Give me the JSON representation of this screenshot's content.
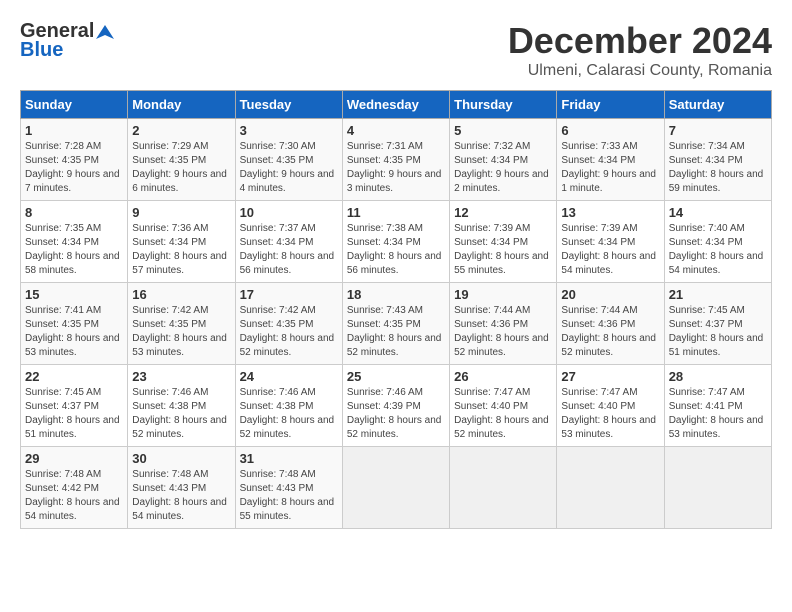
{
  "logo": {
    "general": "General",
    "blue": "Blue"
  },
  "header": {
    "month": "December 2024",
    "location": "Ulmeni, Calarasi County, Romania"
  },
  "weekdays": [
    "Sunday",
    "Monday",
    "Tuesday",
    "Wednesday",
    "Thursday",
    "Friday",
    "Saturday"
  ],
  "weeks": [
    [
      {
        "day": "1",
        "sunrise": "7:28 AM",
        "sunset": "4:35 PM",
        "daylight": "9 hours and 7 minutes."
      },
      {
        "day": "2",
        "sunrise": "7:29 AM",
        "sunset": "4:35 PM",
        "daylight": "9 hours and 6 minutes."
      },
      {
        "day": "3",
        "sunrise": "7:30 AM",
        "sunset": "4:35 PM",
        "daylight": "9 hours and 4 minutes."
      },
      {
        "day": "4",
        "sunrise": "7:31 AM",
        "sunset": "4:35 PM",
        "daylight": "9 hours and 3 minutes."
      },
      {
        "day": "5",
        "sunrise": "7:32 AM",
        "sunset": "4:34 PM",
        "daylight": "9 hours and 2 minutes."
      },
      {
        "day": "6",
        "sunrise": "7:33 AM",
        "sunset": "4:34 PM",
        "daylight": "9 hours and 1 minute."
      },
      {
        "day": "7",
        "sunrise": "7:34 AM",
        "sunset": "4:34 PM",
        "daylight": "8 hours and 59 minutes."
      }
    ],
    [
      {
        "day": "8",
        "sunrise": "7:35 AM",
        "sunset": "4:34 PM",
        "daylight": "8 hours and 58 minutes."
      },
      {
        "day": "9",
        "sunrise": "7:36 AM",
        "sunset": "4:34 PM",
        "daylight": "8 hours and 57 minutes."
      },
      {
        "day": "10",
        "sunrise": "7:37 AM",
        "sunset": "4:34 PM",
        "daylight": "8 hours and 56 minutes."
      },
      {
        "day": "11",
        "sunrise": "7:38 AM",
        "sunset": "4:34 PM",
        "daylight": "8 hours and 56 minutes."
      },
      {
        "day": "12",
        "sunrise": "7:39 AM",
        "sunset": "4:34 PM",
        "daylight": "8 hours and 55 minutes."
      },
      {
        "day": "13",
        "sunrise": "7:39 AM",
        "sunset": "4:34 PM",
        "daylight": "8 hours and 54 minutes."
      },
      {
        "day": "14",
        "sunrise": "7:40 AM",
        "sunset": "4:34 PM",
        "daylight": "8 hours and 54 minutes."
      }
    ],
    [
      {
        "day": "15",
        "sunrise": "7:41 AM",
        "sunset": "4:35 PM",
        "daylight": "8 hours and 53 minutes."
      },
      {
        "day": "16",
        "sunrise": "7:42 AM",
        "sunset": "4:35 PM",
        "daylight": "8 hours and 53 minutes."
      },
      {
        "day": "17",
        "sunrise": "7:42 AM",
        "sunset": "4:35 PM",
        "daylight": "8 hours and 52 minutes."
      },
      {
        "day": "18",
        "sunrise": "7:43 AM",
        "sunset": "4:35 PM",
        "daylight": "8 hours and 52 minutes."
      },
      {
        "day": "19",
        "sunrise": "7:44 AM",
        "sunset": "4:36 PM",
        "daylight": "8 hours and 52 minutes."
      },
      {
        "day": "20",
        "sunrise": "7:44 AM",
        "sunset": "4:36 PM",
        "daylight": "8 hours and 52 minutes."
      },
      {
        "day": "21",
        "sunrise": "7:45 AM",
        "sunset": "4:37 PM",
        "daylight": "8 hours and 51 minutes."
      }
    ],
    [
      {
        "day": "22",
        "sunrise": "7:45 AM",
        "sunset": "4:37 PM",
        "daylight": "8 hours and 51 minutes."
      },
      {
        "day": "23",
        "sunrise": "7:46 AM",
        "sunset": "4:38 PM",
        "daylight": "8 hours and 52 minutes."
      },
      {
        "day": "24",
        "sunrise": "7:46 AM",
        "sunset": "4:38 PM",
        "daylight": "8 hours and 52 minutes."
      },
      {
        "day": "25",
        "sunrise": "7:46 AM",
        "sunset": "4:39 PM",
        "daylight": "8 hours and 52 minutes."
      },
      {
        "day": "26",
        "sunrise": "7:47 AM",
        "sunset": "4:40 PM",
        "daylight": "8 hours and 52 minutes."
      },
      {
        "day": "27",
        "sunrise": "7:47 AM",
        "sunset": "4:40 PM",
        "daylight": "8 hours and 53 minutes."
      },
      {
        "day": "28",
        "sunrise": "7:47 AM",
        "sunset": "4:41 PM",
        "daylight": "8 hours and 53 minutes."
      }
    ],
    [
      {
        "day": "29",
        "sunrise": "7:48 AM",
        "sunset": "4:42 PM",
        "daylight": "8 hours and 54 minutes."
      },
      {
        "day": "30",
        "sunrise": "7:48 AM",
        "sunset": "4:43 PM",
        "daylight": "8 hours and 54 minutes."
      },
      {
        "day": "31",
        "sunrise": "7:48 AM",
        "sunset": "4:43 PM",
        "daylight": "8 hours and 55 minutes."
      },
      null,
      null,
      null,
      null
    ]
  ]
}
